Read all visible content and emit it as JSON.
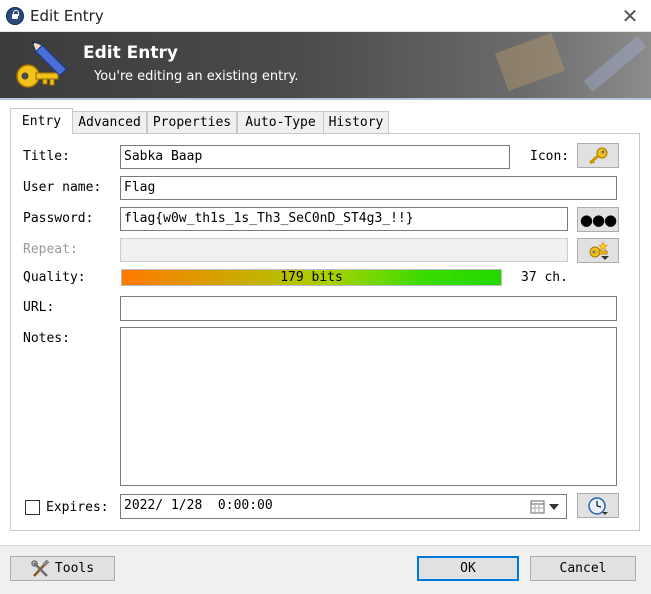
{
  "window": {
    "title": "Edit Entry",
    "close_glyph": "✕"
  },
  "banner": {
    "title": "Edit Entry",
    "subtitle": "You're editing an existing entry."
  },
  "tabs": [
    {
      "label": "Entry",
      "active": true
    },
    {
      "label": "Advanced",
      "active": false
    },
    {
      "label": "Properties",
      "active": false
    },
    {
      "label": "Auto-Type",
      "active": false
    },
    {
      "label": "History",
      "active": false
    }
  ],
  "form": {
    "title_label": "Title:",
    "title_value": "Sabka Baap",
    "icon_label": "Icon:",
    "username_label": "User name:",
    "username_value": "Flag",
    "password_label": "Password:",
    "password_value": "flag{w0w_th1s_1s_Th3_SeC0nD_ST4g3_!!}",
    "repeat_label": "Repeat:",
    "repeat_value": "",
    "quality_label": "Quality:",
    "quality_text": "179 bits",
    "quality_chars": "37 ch.",
    "quality_fraction": 1.0,
    "url_label": "URL:",
    "url_value": "",
    "notes_label": "Notes:",
    "notes_value": "",
    "expires_label": "Expires:",
    "expires_checked": false,
    "expires_value": "2022/ 1/28  0:00:00"
  },
  "buttons": {
    "tools": "Tools",
    "ok": "OK",
    "cancel": "Cancel"
  },
  "icons": {
    "window": "lock-icon",
    "banner": "key-pen-icon",
    "entry": "key-icon",
    "show_password": "dots-icon",
    "generate_password": "password-generator-icon",
    "calendar": "calendar-icon",
    "expiry_presets": "clock-icon",
    "tools": "tools-icon"
  },
  "colors": {
    "banner_dark": "#3c3c3c",
    "accent": "#0078d7",
    "quality_low": "#ff7a00",
    "quality_high": "#22d800"
  }
}
